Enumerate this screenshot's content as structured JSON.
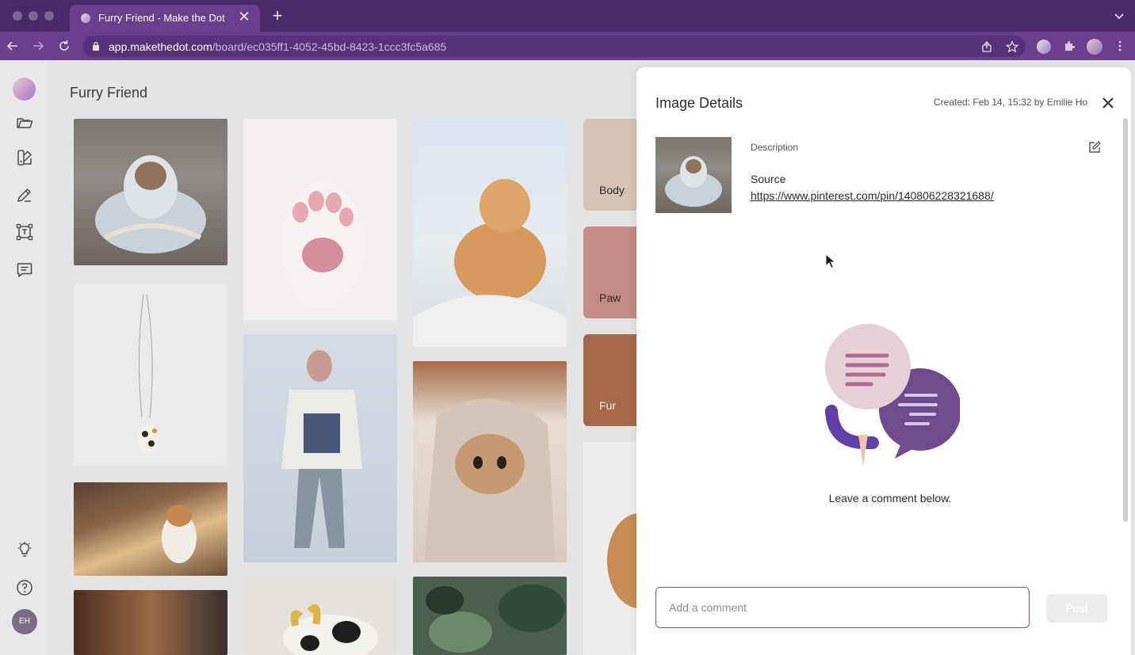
{
  "browser": {
    "tab_title": "Furry Friend - Make the Dot",
    "tab_close": "✕",
    "new_tab": "+",
    "url_host": "app.makethedot.com",
    "url_path": "/board/ec035ff1-4052-45bd-8423-1ccc3fc5a685"
  },
  "sidebar": {
    "items": [
      {
        "name": "folder-icon"
      },
      {
        "name": "palette-icon"
      },
      {
        "name": "pencil-icon"
      },
      {
        "name": "text-frame-icon"
      },
      {
        "name": "comment-icon"
      },
      {
        "name": "lightbulb-icon"
      },
      {
        "name": "help-icon"
      }
    ],
    "avatar_initials": "EH"
  },
  "board": {
    "title": "Furry Friend",
    "swatches": [
      {
        "label": "Body",
        "color": "#d8c2b4"
      },
      {
        "label": "Paw",
        "color": "#c48a83"
      },
      {
        "label": "Fur",
        "color": "#a56848"
      }
    ]
  },
  "panel": {
    "title": "Image Details",
    "meta": "Created: Feb 14, 15:32 by Emilie Ho",
    "description_label": "Description",
    "source_label": "Source",
    "source_url": "https://www.pinterest.com/pin/140806228321688/",
    "empty_text": "Leave a comment below.",
    "comment_placeholder": "Add a comment",
    "post_label": "Post"
  },
  "colors": {
    "accent": "#6a3f8e",
    "input_border": "#7a4fa0"
  }
}
